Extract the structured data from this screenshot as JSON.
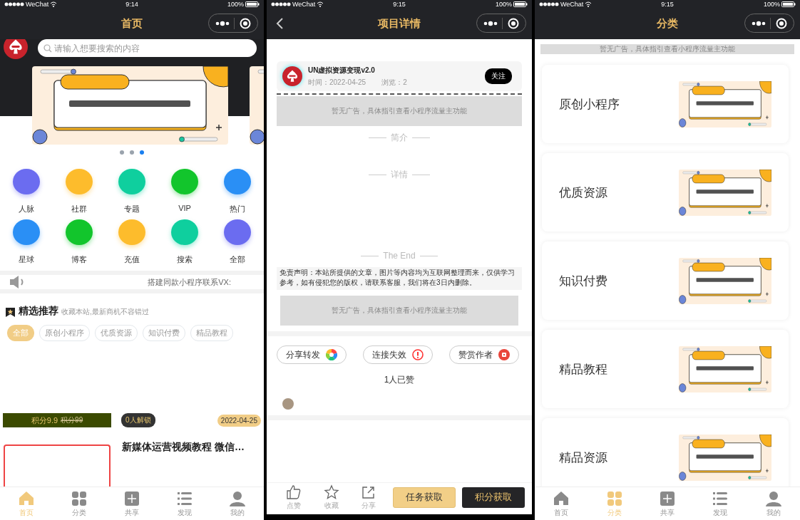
{
  "home": {
    "status_bar": {
      "carrier": "WeChat",
      "time": "9:14",
      "battery": "100%"
    },
    "nav": {
      "title": "首页"
    },
    "search": {
      "placeholder": "请输入想要搜索的内容"
    },
    "banner_dots": [
      {
        "selected": false
      },
      {
        "selected": false
      },
      {
        "selected": true
      }
    ],
    "shortcuts": [
      {
        "label": "人脉",
        "color": "#6b6cf0"
      },
      {
        "label": "社群",
        "color": "#fdbc2c"
      },
      {
        "label": "专题",
        "color": "#0fcf9e"
      },
      {
        "label": "VIP",
        "color": "#12c52c"
      },
      {
        "label": "热门",
        "color": "#2a8ff5"
      },
      {
        "label": "星球",
        "color": "#2a8ff5"
      },
      {
        "label": "博客",
        "color": "#12c52c"
      },
      {
        "label": "充值",
        "color": "#fdbc2c"
      },
      {
        "label": "搜索",
        "color": "#0fcf9e"
      },
      {
        "label": "全部",
        "color": "#6b6cf0"
      }
    ],
    "notice": "搭建同款小程序联系VX:",
    "section": {
      "title": "精选推荐",
      "subtitle": "收藏本站,最新商机不容错过"
    },
    "chips": [
      {
        "label": "全部",
        "selected": true
      },
      {
        "label": "原创小程序",
        "selected": false
      },
      {
        "label": "优质资源",
        "selected": false
      },
      {
        "label": "知识付费",
        "selected": false
      },
      {
        "label": "精品教程",
        "selected": false
      }
    ],
    "post": {
      "price": "积分9.9",
      "original_price": "积分99",
      "unlocks": "0人解锁",
      "date": "2022-04-25",
      "title": "新媒体运营视频教程 微信…"
    },
    "tab_bar": [
      {
        "label": "首页",
        "selected": true
      },
      {
        "label": "分类",
        "selected": false
      },
      {
        "label": "共享",
        "selected": false
      },
      {
        "label": "发现",
        "selected": false
      },
      {
        "label": "我的",
        "selected": false
      }
    ]
  },
  "detail": {
    "status_bar": {
      "carrier": "WeChat",
      "time": "9:15",
      "battery": "100%"
    },
    "nav": {
      "title": "项目详情"
    },
    "author": {
      "name": "UN虚拟资源变现v2.0",
      "time": "时间：2022-04-25",
      "views": "浏览：2",
      "follow": "关注"
    },
    "ad_top": "暂无广告，具体指引查看小程序流量主功能",
    "intro_heading": "简介",
    "detail_heading": "详情",
    "end_heading": "The End",
    "disclaimer": "免责声明：本站所提供的文章，图片等内容均为互联网整理而来，仅供学习参考，如有侵犯您的版权，请联系客服，我们将在3日内删除。",
    "ad_bottom": "暂无广告，具体指引查看小程序流量主功能",
    "actions": [
      {
        "label": "分享转发"
      },
      {
        "label": "连接失效"
      },
      {
        "label": "赞赏作者"
      }
    ],
    "likes": "1人已赞",
    "bottom_bar": {
      "tools": [
        {
          "label": "点赞"
        },
        {
          "label": "收藏"
        },
        {
          "label": "分享"
        }
      ],
      "task_button": "任务获取",
      "points_button": "积分获取"
    }
  },
  "category": {
    "status_bar": {
      "carrier": "WeChat",
      "time": "9:15",
      "battery": "100%"
    },
    "nav": {
      "title": "分类"
    },
    "ad": "暂无广告，具体指引查看小程序流量主功能",
    "cards": [
      {
        "label": "原创小程序"
      },
      {
        "label": "优质资源"
      },
      {
        "label": "知识付费"
      },
      {
        "label": "精品教程"
      },
      {
        "label": "精品资源"
      }
    ],
    "tab_bar": [
      {
        "label": "首页",
        "selected": false
      },
      {
        "label": "分类",
        "selected": true
      },
      {
        "label": "共享",
        "selected": false
      },
      {
        "label": "发现",
        "selected": false
      },
      {
        "label": "我的",
        "selected": false
      }
    ]
  }
}
